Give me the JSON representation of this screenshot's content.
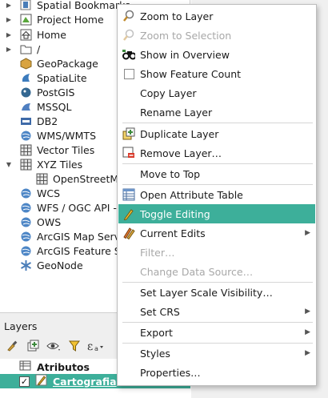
{
  "browser": {
    "items": [
      {
        "label": "Spatial Bookmarks",
        "icon": "bookmark-icon",
        "arrow": "▶"
      },
      {
        "label": "Project Home",
        "icon": "project-home-icon",
        "arrow": "▶"
      },
      {
        "label": "Home",
        "icon": "home-icon",
        "arrow": "▶"
      },
      {
        "label": "/",
        "icon": "folder-icon",
        "arrow": "▶"
      },
      {
        "label": "GeoPackage",
        "icon": "geopackage-icon",
        "arrow": ""
      },
      {
        "label": "SpatiaLite",
        "icon": "spatialite-icon",
        "arrow": ""
      },
      {
        "label": "PostGIS",
        "icon": "postgis-icon",
        "arrow": ""
      },
      {
        "label": "MSSQL",
        "icon": "mssql-icon",
        "arrow": ""
      },
      {
        "label": "DB2",
        "icon": "db2-icon",
        "arrow": ""
      },
      {
        "label": "WMS/WMTS",
        "icon": "wms-icon",
        "arrow": ""
      },
      {
        "label": "Vector Tiles",
        "icon": "vector-tiles-icon",
        "arrow": ""
      },
      {
        "label": "XYZ Tiles",
        "icon": "xyz-tiles-icon",
        "arrow": "▼"
      },
      {
        "label": "OpenStreetMa",
        "icon": "xyz-layer-icon",
        "arrow": ""
      },
      {
        "label": "WCS",
        "icon": "wcs-icon",
        "arrow": ""
      },
      {
        "label": "WFS / OGC API -",
        "icon": "wfs-icon",
        "arrow": ""
      },
      {
        "label": "OWS",
        "icon": "ows-icon",
        "arrow": ""
      },
      {
        "label": "ArcGIS Map Servi",
        "icon": "arcgis-map-icon",
        "arrow": ""
      },
      {
        "label": "ArcGIS Feature Se",
        "icon": "arcgis-feature-icon",
        "arrow": ""
      },
      {
        "label": "GeoNode",
        "icon": "geonode-icon",
        "arrow": ""
      }
    ]
  },
  "layers": {
    "title": "Layers",
    "rows": [
      {
        "label": "Atributos"
      },
      {
        "label": "Cartografia",
        "checkbox": "✓"
      }
    ]
  },
  "menu": {
    "items": {
      "zoom_to_layer": "Zoom to Layer",
      "zoom_to_selection": "Zoom to Selection",
      "show_in_overview": "Show in Overview",
      "show_feature_count": "Show Feature Count",
      "copy_layer": "Copy Layer",
      "rename_layer": "Rename Layer",
      "duplicate_layer": "Duplicate Layer",
      "remove_layer": "Remove Layer…",
      "move_to_top": "Move to Top",
      "open_attribute_table": "Open Attribute Table",
      "toggle_editing": "Toggle Editing",
      "current_edits": "Current Edits",
      "filter": "Filter…",
      "change_data_source": "Change Data Source…",
      "set_layer_scale_visibility": "Set Layer Scale Visibility…",
      "set_crs": "Set CRS",
      "export": "Export",
      "styles": "Styles",
      "properties": "Properties…"
    },
    "submenu_arrow": "▶"
  },
  "colors": {
    "highlight": "#3daf9a",
    "disabled_text": "#a8a8a8"
  }
}
